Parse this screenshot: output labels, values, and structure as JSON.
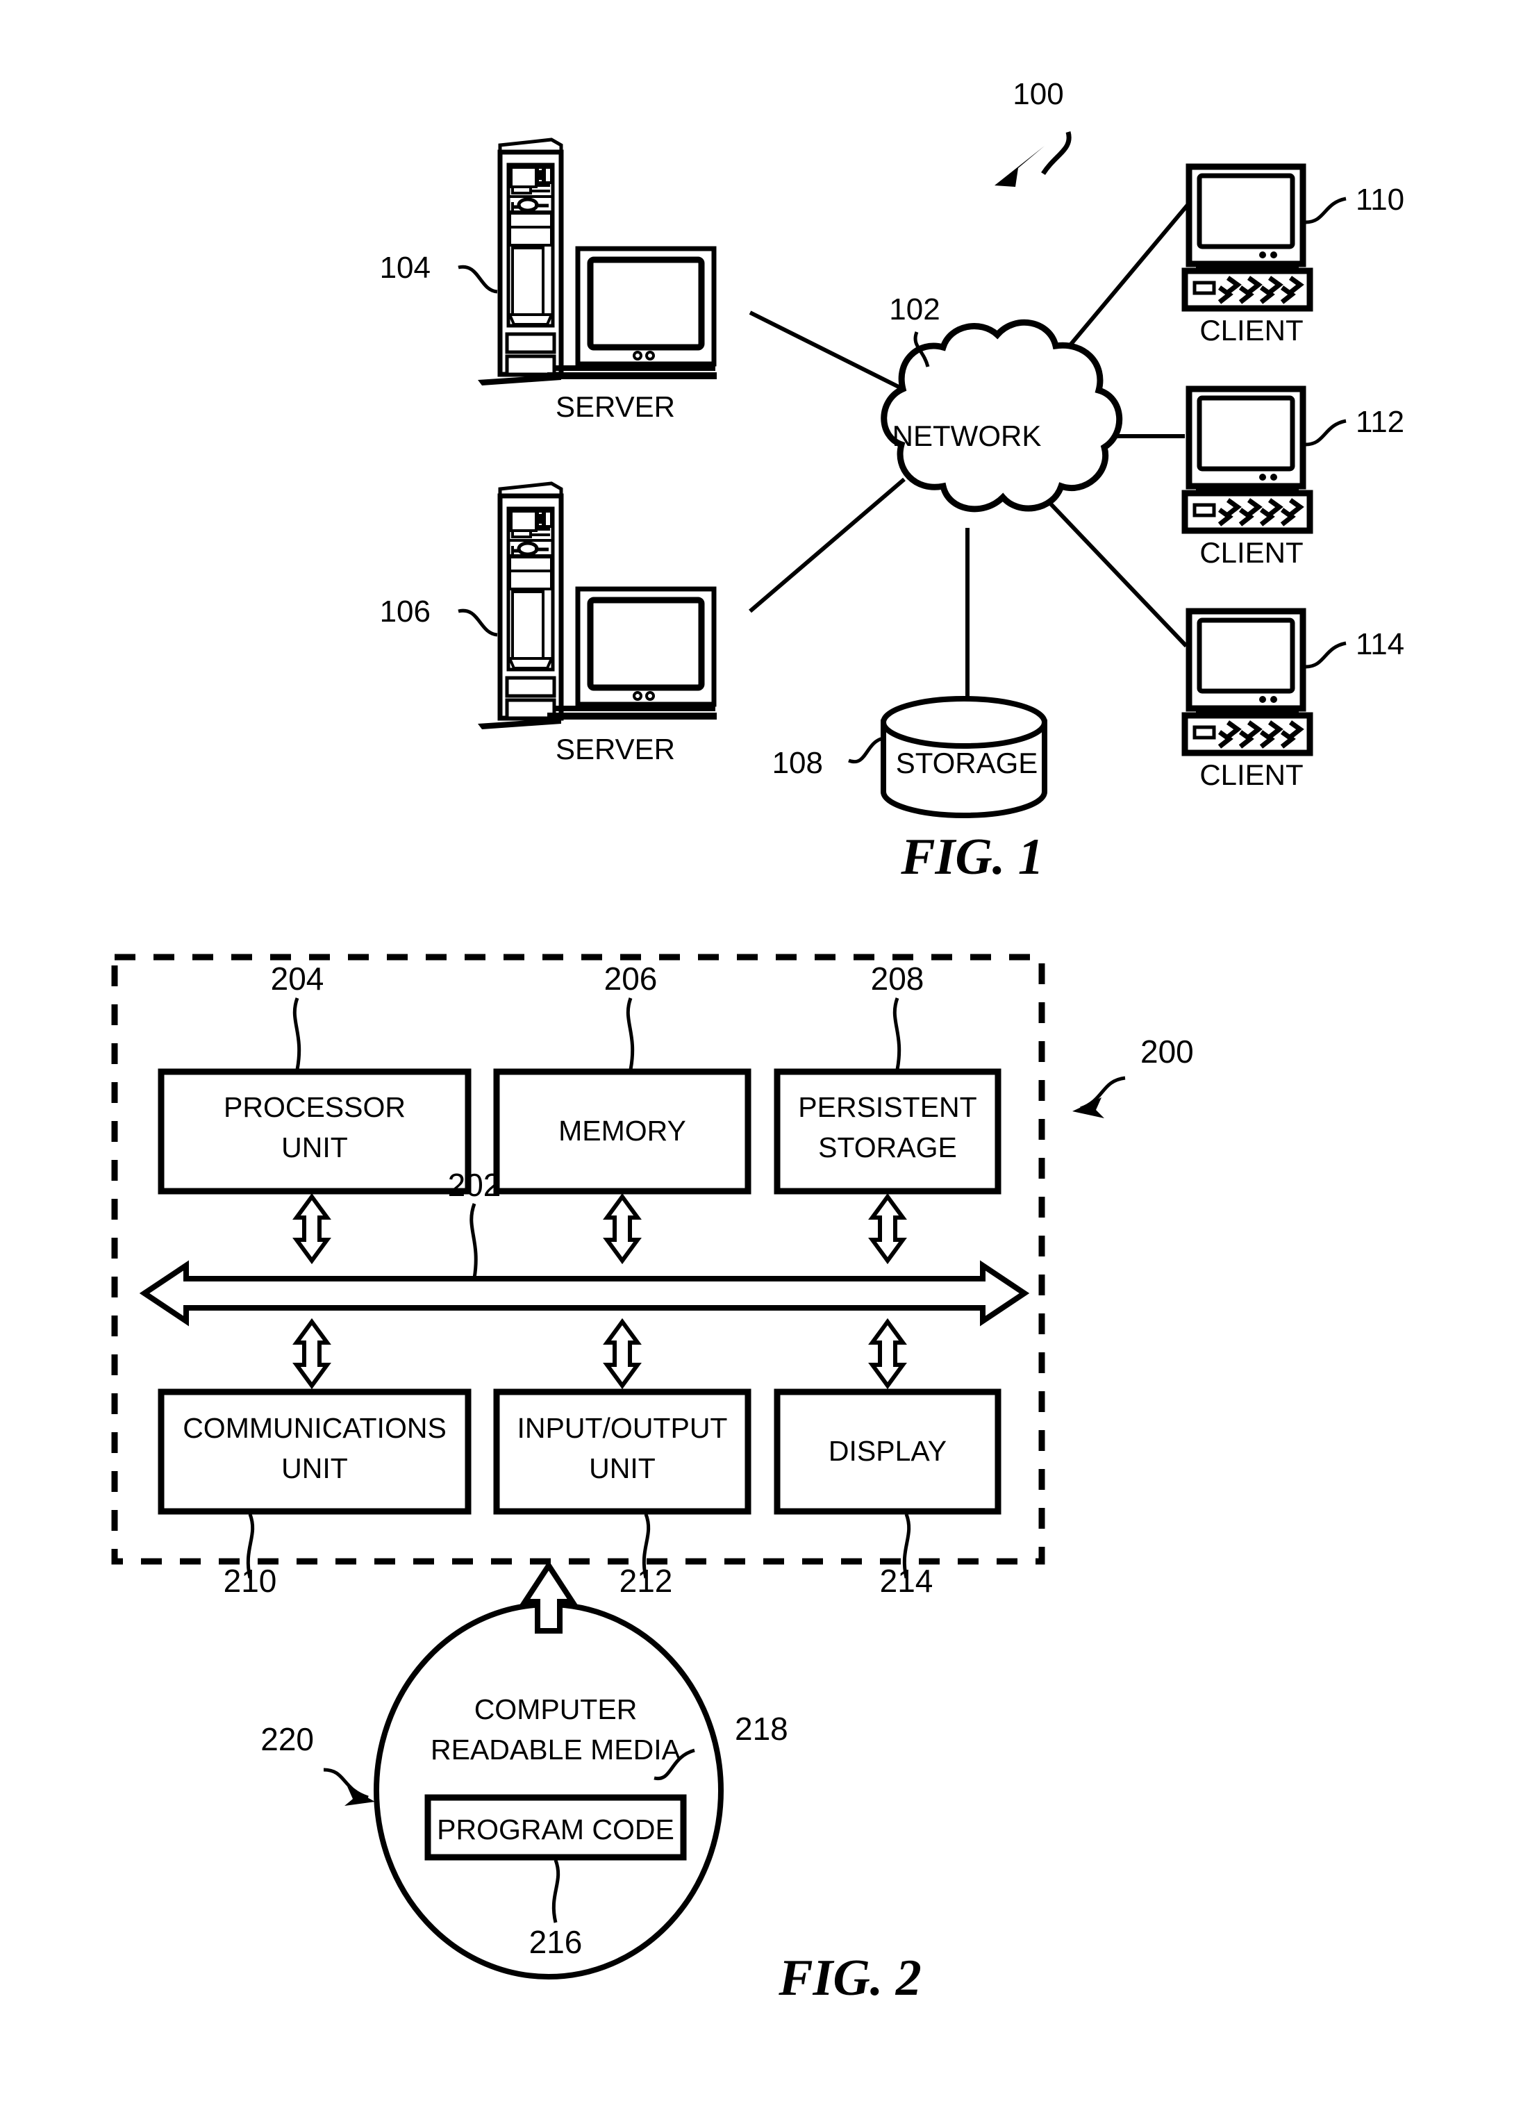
{
  "document": {
    "type": "patent-drawing-sheet",
    "figures": [
      "FIG. 1",
      "FIG. 2"
    ],
    "ink_color": "#000000",
    "background_color": "#ffffff"
  },
  "figure1": {
    "caption": "FIG. 1",
    "system_ref": "100",
    "network": {
      "label": "NETWORK",
      "ref": "102"
    },
    "storage": {
      "label": "STORAGE",
      "ref": "108"
    },
    "servers": [
      {
        "label": "SERVER",
        "ref": "104"
      },
      {
        "label": "SERVER",
        "ref": "106"
      }
    ],
    "clients": [
      {
        "label": "CLIENT",
        "ref": "110"
      },
      {
        "label": "CLIENT",
        "ref": "112"
      },
      {
        "label": "CLIENT",
        "ref": "114"
      }
    ]
  },
  "figure2": {
    "caption": "FIG. 2",
    "data_processing_system_ref": "200",
    "bus": {
      "ref": "202",
      "name": "communications-fabric-bus"
    },
    "top_units": [
      {
        "line1": "PROCESSOR",
        "line2": "UNIT",
        "ref": "204"
      },
      {
        "line1": "MEMORY",
        "line2": "",
        "ref": "206"
      },
      {
        "line1": "PERSISTENT",
        "line2": "STORAGE",
        "ref": "208"
      }
    ],
    "bottom_units": [
      {
        "line1": "COMMUNICATIONS",
        "line2": "UNIT",
        "ref": "210"
      },
      {
        "line1": "INPUT/OUTPUT",
        "line2": "UNIT",
        "ref": "212"
      },
      {
        "line1": "DISPLAY",
        "line2": "",
        "ref": "214"
      }
    ],
    "media": {
      "line1": "COMPUTER",
      "line2": "READABLE MEDIA",
      "ref": "218",
      "outer_ref": "220",
      "program_code": {
        "label": "PROGRAM CODE",
        "ref": "216"
      }
    }
  }
}
